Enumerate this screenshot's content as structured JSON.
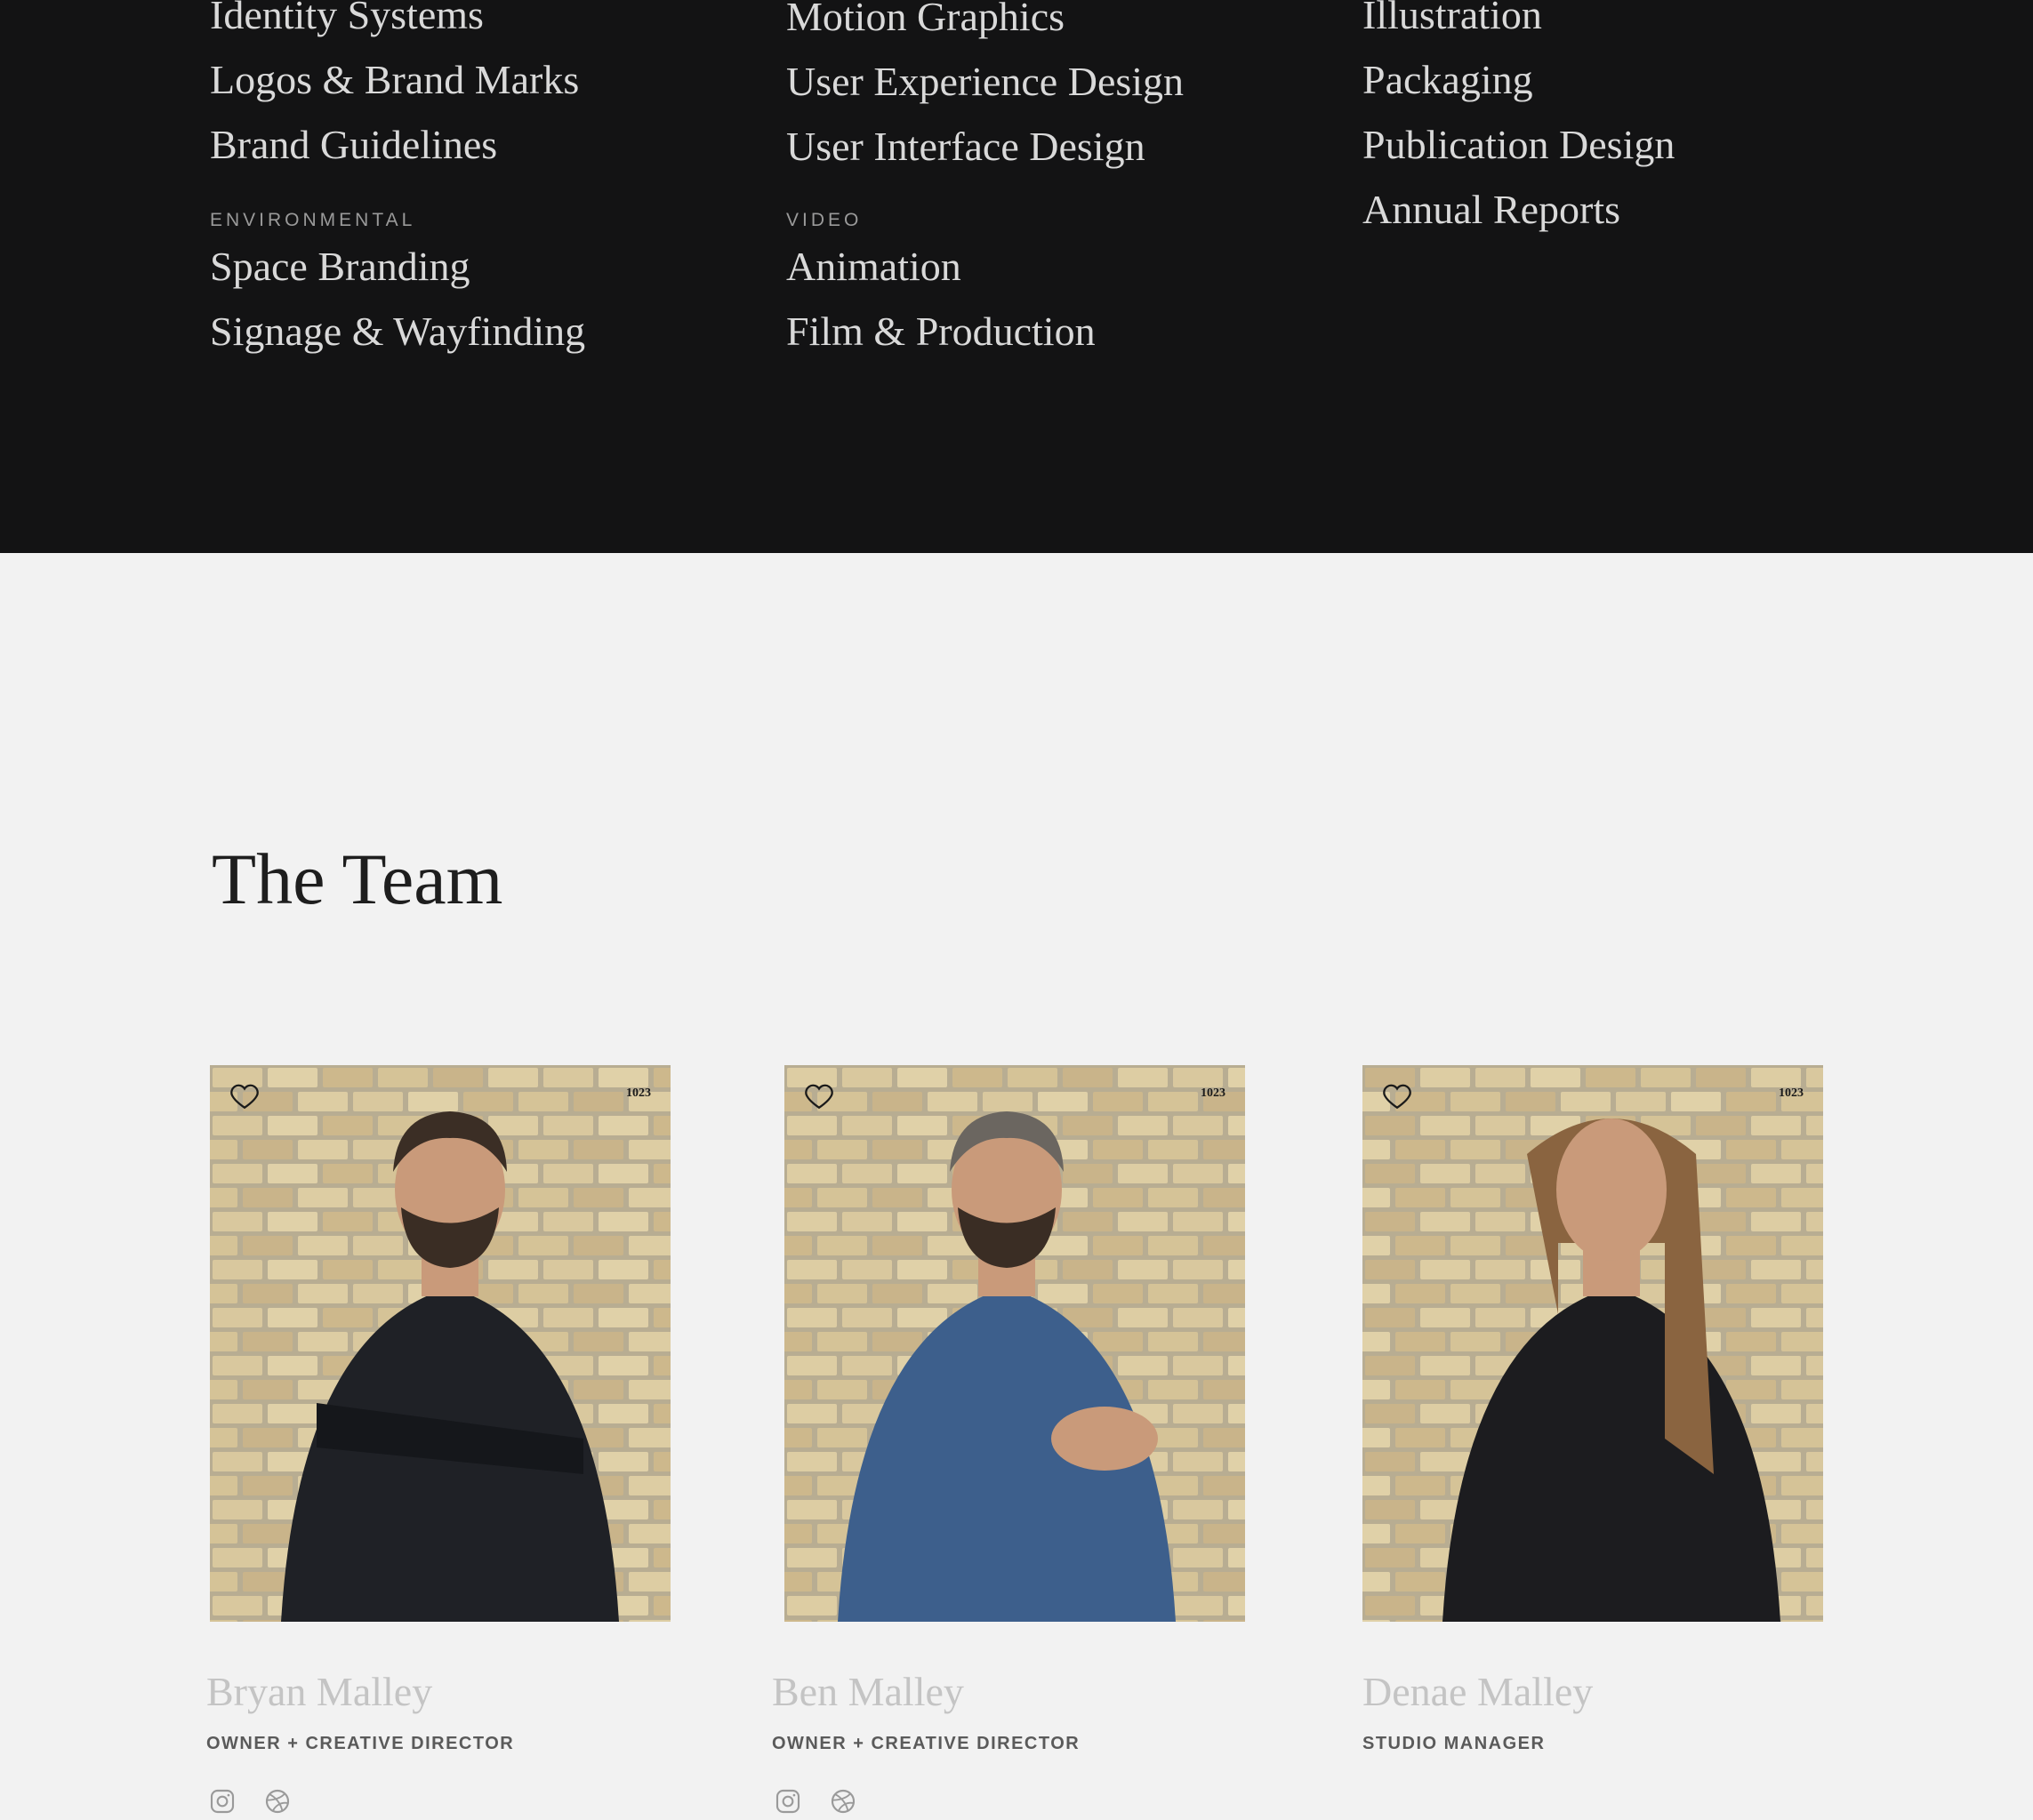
{
  "services": {
    "columns": [
      {
        "links_top": [
          "Identity Systems",
          "Logos & Brand Marks",
          "Brand Guidelines"
        ],
        "category": "ENVIRONMENTAL",
        "links_bottom": [
          "Space Branding",
          "Signage & Wayfinding"
        ]
      },
      {
        "links_top": [
          "Motion Graphics",
          "User Experience Design",
          "User Interface Design"
        ],
        "category": "VIDEO",
        "links_bottom": [
          "Animation",
          "Film & Production"
        ]
      },
      {
        "links_top": [
          "Illustration",
          "Packaging",
          "Publication Design",
          "Annual Reports"
        ]
      }
    ]
  },
  "team": {
    "title": "The Team",
    "members": [
      {
        "name": "Bryan Malley",
        "role": "OWNER + CREATIVE DIRECTOR",
        "photo_mark": "1023",
        "shirt_color": "#1f2126",
        "hair_color": "#3b2e25"
      },
      {
        "name": "Ben Malley",
        "role": "OWNER + CREATIVE DIRECTOR",
        "photo_mark": "1023",
        "shirt_color": "#3d5f8c",
        "hair_color": "#6b6660"
      },
      {
        "name": "Denae Malley",
        "role": "STUDIO MANAGER",
        "photo_mark": "1023",
        "shirt_color": "#1c1c1f",
        "hair_color": "#8a6440"
      }
    ]
  },
  "icons": [
    "heart-icon",
    "instagram-icon",
    "dribbble-icon"
  ],
  "colors": {
    "dark_bg": "#131314",
    "light_bg": "#f2f2f2",
    "brick": "#d8c69c"
  }
}
